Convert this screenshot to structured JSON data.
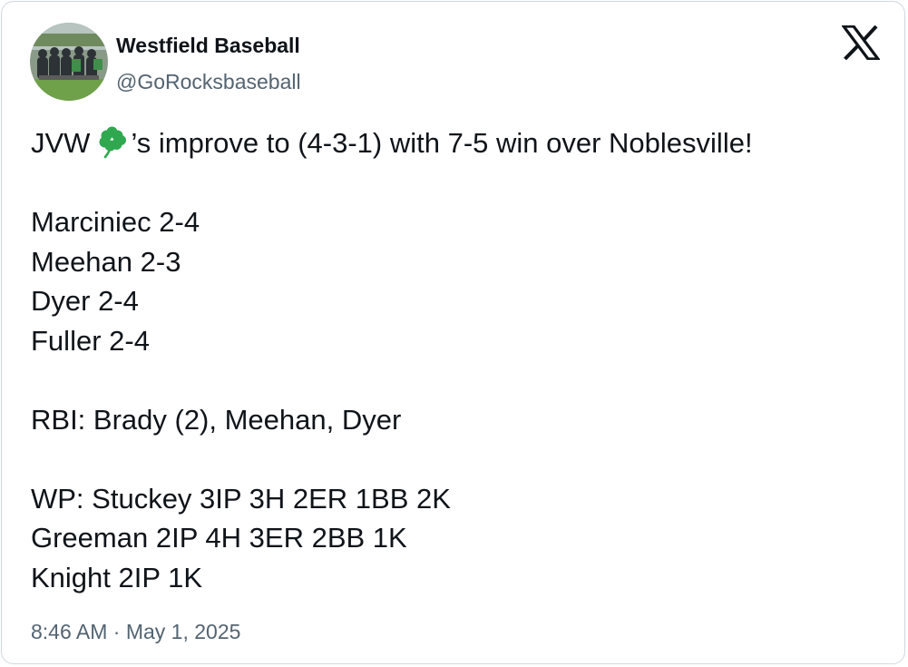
{
  "author": {
    "display_name": "Westfield Baseball",
    "handle": "@GoRocksbaseball"
  },
  "brand": {
    "logo_icon": "x-logo-icon",
    "color": "#0f1419"
  },
  "tweet": {
    "intro_before_emoji": "JVW",
    "emoji_icon": "shamrock-emoji",
    "intro_after_emoji": "’s improve to (4-3-1) with 7-5 win over Noblesville!",
    "hitters": [
      "Marciniec 2-4",
      "Meehan 2-3",
      "Dyer 2-4",
      "Fuller 2-4"
    ],
    "rbi": "RBI: Brady (2), Meehan, Dyer",
    "pitchers": [
      "WP: Stuckey 3IP 3H 2ER 1BB 2K",
      "Greeman 2IP 4H 3ER 2BB 1K",
      "Knight 2IP 1K"
    ]
  },
  "timestamp": "8:46 AM · May 1, 2025",
  "colors": {
    "text": "#0f1419",
    "secondary_text": "#536471",
    "border": "#cfd9de",
    "shamrock": "#2fa84f"
  }
}
